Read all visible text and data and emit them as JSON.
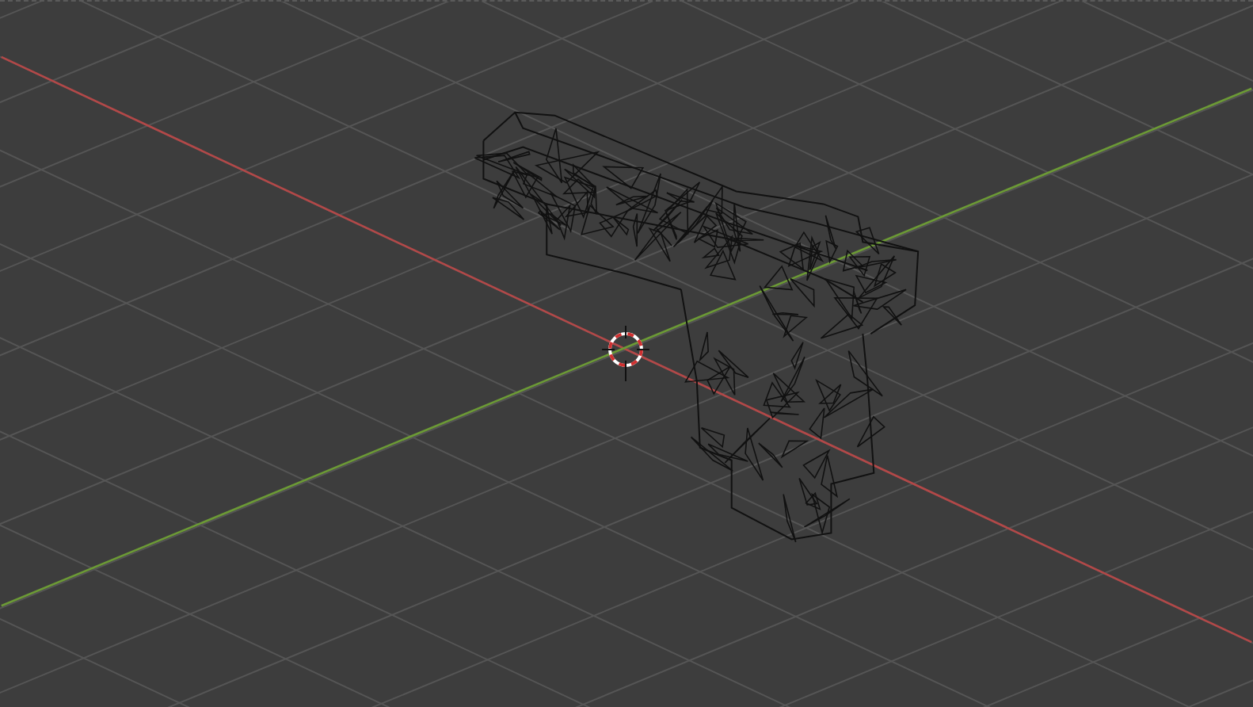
{
  "viewport": {
    "cursor": true,
    "axes": [
      {
        "kind": "x",
        "color": "#b34848"
      },
      {
        "kind": "y",
        "color": "#6c9a36"
      }
    ]
  }
}
